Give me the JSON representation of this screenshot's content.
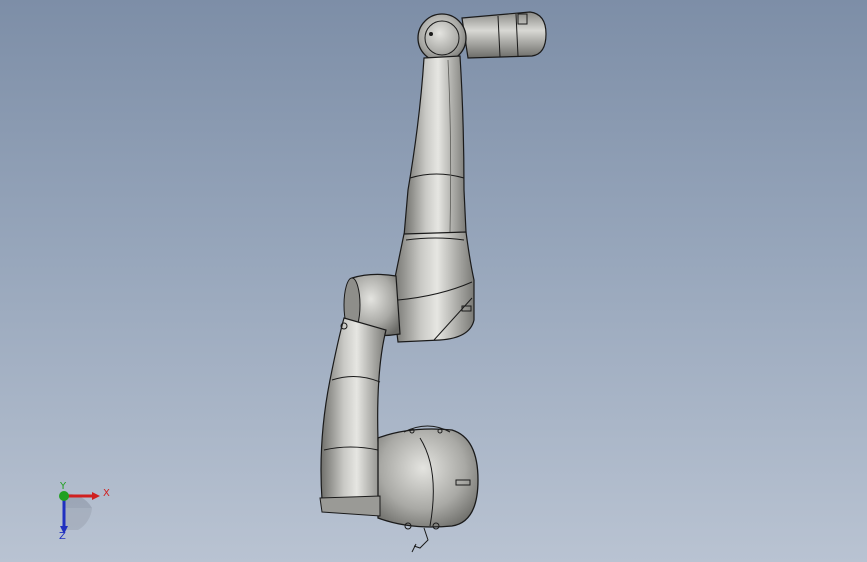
{
  "viewport": {
    "background_top": "#7d8ea7",
    "background_bottom": "#b9c3d2"
  },
  "model": {
    "description_icon": "robot-arm-model",
    "body_color": "#a8a8a4",
    "edge_color": "#1a1a1a"
  },
  "triad": {
    "x_label": "X",
    "y_label": "Y",
    "z_label": "Z",
    "x_color": "#d02020",
    "y_color": "#20a020",
    "z_color": "#2030c0"
  }
}
